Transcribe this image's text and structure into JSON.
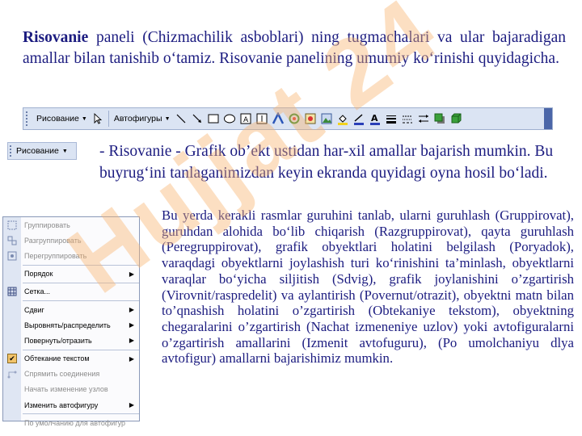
{
  "para1": {
    "bold": "Risovanie",
    "text": " paneli (Chizmachilik asboblari) ning tugmachalari va ular bajaradigan amallar bilan tanishib o‘tamiz. Risovanie panelining umumiy ko‘rinishi quyidagicha."
  },
  "toolbar": {
    "risovanie_label": "Рисование",
    "autoshapes_label": "Автофигуры",
    "accent_color": "#dbe4f3"
  },
  "risbutton": {
    "label": "Рисование"
  },
  "para2": "- Risovanie - Grafik ob’ekt ustidan har-xil amallar bajarish mumkin. Bu buyrug‘ini tanlaganimizdan keyin ekranda quyidagi oyna hosil bo‘ladi.",
  "para3": "Bu yerda kerakli rasmlar guruhini tanlab, ularni guruhlash (Gruppirovat), guruhdan alohida bo‘lib chiqarish (Razgruppirovat), qayta guruhlash (Peregruppirovat), grafik obyektlari holatini belgilash (Poryadok), varaqdagi obyektlarni joylashish turi ko‘rinishini ta’minlash, obyektlarni varaqlar bo‘yicha siljitish (Sdvig), grafik joylanishini o’zgartirish (Virovnit/raspredelit) va aylantirish (Povernut/otrazit), obyektni matn bilan to’qnashish holatini o’zgartirish (Obtekaniye tekstom), obyektning chegaralarini o’zgartirish (Nachat izmeneniye uzlov) yoki avtofiguralarni o’zgartirish amallarini (Izmenit avtofuguru), (Po umolchaniyu dlya avtofigur) amallarni bajarishimiz mumkin.",
  "menu": {
    "items": [
      {
        "label": "Группировать",
        "icon": "group-icon",
        "disabled": true
      },
      {
        "label": "Разгруппировать",
        "icon": "ungroup-icon",
        "disabled": true
      },
      {
        "label": "Перегруппировать",
        "icon": "regroup-icon",
        "disabled": true
      },
      {
        "label": "Порядок",
        "submenu": true
      },
      {
        "label": "Сетка...",
        "icon": "grid-icon"
      },
      {
        "label": "Сдвиг",
        "submenu": true
      },
      {
        "label": "Выровнять/распределить",
        "submenu": true
      },
      {
        "label": "Повернуть/отразить",
        "submenu": true
      },
      {
        "label": "Обтекание текстом",
        "icon": "text-wrap-icon",
        "submenu": true
      },
      {
        "label": "Спрямить соединения",
        "icon": "reroute-icon",
        "disabled": true
      },
      {
        "label": "Начать изменение узлов",
        "disabled": true
      },
      {
        "label": "Изменить автофигуру",
        "submenu": true
      },
      {
        "label": "По умолчанию для автофигур",
        "disabled": true
      }
    ]
  },
  "watermark": "Hujjat 24"
}
